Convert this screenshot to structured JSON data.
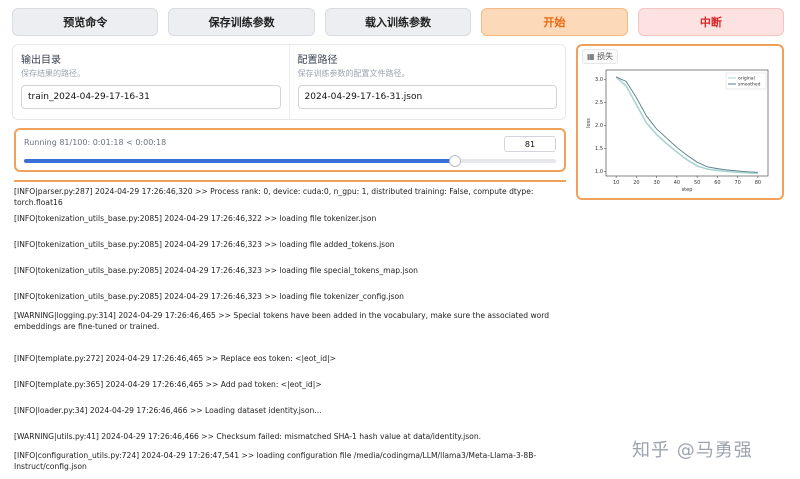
{
  "toolbar": {
    "preview": "预览命令",
    "save": "保存训练参数",
    "load": "载入训练参数",
    "start": "开始",
    "abort": "中断"
  },
  "output_dir": {
    "label": "输出目录",
    "hint": "保存结果的路径。",
    "value": "train_2024-04-29-17-16-31"
  },
  "config_path": {
    "label": "配置路径",
    "hint": "保存训练参数的配置文件路径。",
    "value": "2024-04-29-17-16-31.json"
  },
  "progress": {
    "text": "Running 81/100: 0:01:18 < 0:00:18",
    "value": "81",
    "fraction": 0.81
  },
  "loss_panel": {
    "title": "损失"
  },
  "chart_data": {
    "type": "line",
    "title": "",
    "xlabel": "step",
    "ylabel": "loss",
    "xlim": [
      5,
      85
    ],
    "ylim": [
      0.9,
      3.2
    ],
    "xticks": [
      "10",
      "20",
      "30",
      "40",
      "50",
      "60",
      "70",
      "80"
    ],
    "yticks": [
      "1.0",
      "1.5",
      "2.0",
      "2.5",
      "3.0"
    ],
    "legend_position": "top-right",
    "series": [
      {
        "name": "original",
        "color": "#a8d5d0",
        "x": [
          10,
          15,
          20,
          25,
          30,
          35,
          40,
          45,
          50,
          55,
          60,
          65,
          70,
          75,
          80
        ],
        "values": [
          3.05,
          2.85,
          2.45,
          2.05,
          1.8,
          1.6,
          1.42,
          1.25,
          1.12,
          1.05,
          1.02,
          1.0,
          0.98,
          0.97,
          0.96
        ]
      },
      {
        "name": "smoothed",
        "color": "#5a7d86",
        "x": [
          10,
          15,
          20,
          25,
          30,
          35,
          40,
          45,
          50,
          55,
          60,
          65,
          70,
          75,
          80
        ],
        "values": [
          3.05,
          2.95,
          2.6,
          2.2,
          1.92,
          1.72,
          1.52,
          1.35,
          1.2,
          1.1,
          1.06,
          1.03,
          1.01,
          0.99,
          0.98
        ]
      }
    ]
  },
  "logs": [
    "[INFO|parser.py:287] 2024-04-29 17:26:46,320 >> Process rank: 0, device: cuda:0, n_gpu: 1, distributed training: False, compute dtype: torch.float16",
    "[INFO|tokenization_utils_base.py:2085] 2024-04-29 17:26:46,322 >> loading file tokenizer.json",
    "[INFO|tokenization_utils_base.py:2085] 2024-04-29 17:26:46,323 >> loading file added_tokens.json",
    "[INFO|tokenization_utils_base.py:2085] 2024-04-29 17:26:46,323 >> loading file special_tokens_map.json",
    "[INFO|tokenization_utils_base.py:2085] 2024-04-29 17:26:46,323 >> loading file tokenizer_config.json",
    "[WARNING|logging.py:314] 2024-04-29 17:26:46,465 >> Special tokens have been added in the vocabulary, make sure the associated word embeddings are fine-tuned or trained.",
    "[INFO|template.py:272] 2024-04-29 17:26:46,465 >> Replace eos token: <|eot_id|>",
    "[INFO|template.py:365] 2024-04-29 17:26:46,465 >> Add pad token: <|eot_id|>",
    "[INFO|loader.py:34] 2024-04-29 17:26:46,466 >> Loading dataset identity.json...",
    "[WARNING|utils.py:41] 2024-04-29 17:26:46,466 >> Checksum failed: mismatched SHA-1 hash value at data/identity.json.",
    "[INFO|configuration_utils.py:724] 2024-04-29 17:26:47,541 >> loading configuration file /media/codingma/LLM/llama3/Meta-Llama-3-8B-Instruct/config.json"
  ],
  "watermark": "知乎 @马勇强"
}
